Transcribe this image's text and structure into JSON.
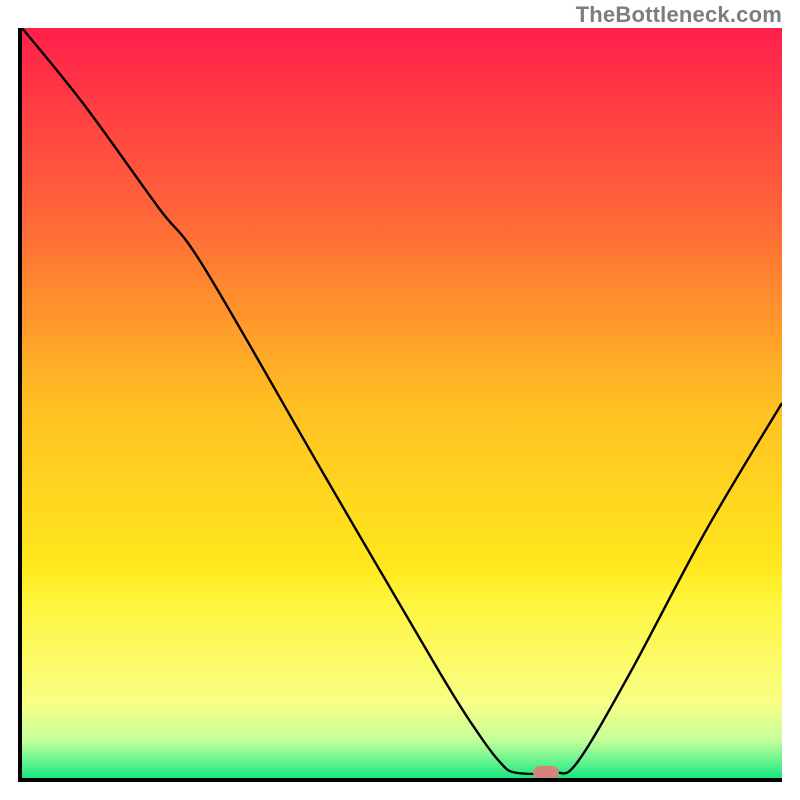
{
  "attribution": "TheBottleneck.com",
  "colors": {
    "gradient_stops": [
      {
        "offset": "0%",
        "color": "#ff1f4a"
      },
      {
        "offset": "25%",
        "color": "#ff6638"
      },
      {
        "offset": "50%",
        "color": "#ffbf22"
      },
      {
        "offset": "72%",
        "color": "#ffe81e"
      },
      {
        "offset": "76%",
        "color": "#fff43a"
      },
      {
        "offset": "90%",
        "color": "#f8ff86"
      },
      {
        "offset": "95%",
        "color": "#c4ff9a"
      },
      {
        "offset": "98%",
        "color": "#5df28e"
      },
      {
        "offset": "100%",
        "color": "#17e87e"
      }
    ],
    "marker": "#d4847f",
    "curve": "#000000"
  },
  "chart_data": {
    "type": "line",
    "title": "",
    "xlabel": "",
    "ylabel": "",
    "xlim": [
      0,
      100
    ],
    "ylim": [
      0,
      100
    ],
    "grid": false,
    "legend": false,
    "series": [
      {
        "name": "bottleneck-curve",
        "points": [
          {
            "x": 0,
            "y": 100
          },
          {
            "x": 8,
            "y": 90
          },
          {
            "x": 18,
            "y": 76
          },
          {
            "x": 24,
            "y": 68
          },
          {
            "x": 40,
            "y": 40
          },
          {
            "x": 55,
            "y": 14
          },
          {
            "x": 60,
            "y": 6
          },
          {
            "x": 63,
            "y": 2
          },
          {
            "x": 65,
            "y": 0.7
          },
          {
            "x": 70,
            "y": 0.7
          },
          {
            "x": 73,
            "y": 2
          },
          {
            "x": 80,
            "y": 14
          },
          {
            "x": 90,
            "y": 33
          },
          {
            "x": 100,
            "y": 50
          }
        ]
      }
    ],
    "marker": {
      "x": 69,
      "y": 0.7
    }
  }
}
